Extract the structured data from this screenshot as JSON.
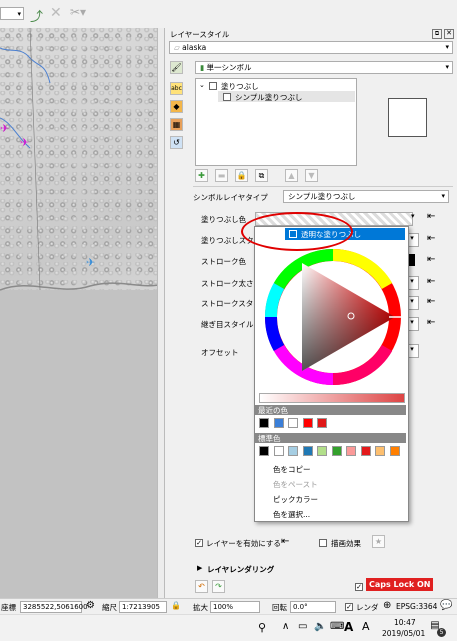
{
  "panel": {
    "title": "レイヤースタイル",
    "layer_name": "alaska",
    "renderer": "単一シンボル",
    "tree_fill": "塗りつぶし",
    "tree_simple_fill": "シンプル塗りつぶし",
    "symbol_layer_type_label": "シンボルレイヤタイプ",
    "symbol_layer_type_value": "シンプル塗りつぶし",
    "props": {
      "fill_color": "塗りつぶし色",
      "fill_style": "塗りつぶしスタイル",
      "stroke_color": "ストローク色",
      "stroke_width": "ストローク太さ",
      "stroke_style": "ストロークスタイル",
      "join_style": "継ぎ目スタイル",
      "offset": "オフセット"
    },
    "enable_layer": "レイヤーを有効にする",
    "draw_effects": "描画効果",
    "layer_rendering": "レイヤレンダリング"
  },
  "popup": {
    "transparent_fill": "透明な塗りつぶし",
    "recent_colors_label": "最近の色",
    "standard_colors_label": "標準色",
    "recent_colors": [
      "#000000",
      "#3b7fd8",
      "#ffffff",
      "#ff0000",
      "#e01818"
    ],
    "standard_colors": [
      "#000000",
      "#ffffff",
      "#a6cee3",
      "#1f78b4",
      "#b2df8a",
      "#33a02c",
      "#fb9a99",
      "#e31a1c",
      "#fdbf6f",
      "#ff7f00"
    ],
    "menu": {
      "copy_color": "色をコピー",
      "paste_color": "色をペースト",
      "pick_color": "ピックカラー",
      "choose_color": "色を選択..."
    }
  },
  "statusbar": {
    "coord_label": "座標",
    "coord_value": "3285522,5061600",
    "scale_label": "縮尺",
    "scale_value": "1:7213905",
    "magnifier_label": "拡大",
    "magnifier_value": "100%",
    "rotation_label": "回転",
    "rotation_value": "0.0°",
    "render_label": "レンダ",
    "crs": "EPSG:3364",
    "caps_lock": "Caps Lock ON"
  },
  "taskbar": {
    "time": "10:47",
    "date": "2019/05/01",
    "notifications": "5"
  },
  "colors": {
    "highlight": "#0078d7",
    "annotation_red": "#e00000",
    "caps_badge": "#e02020"
  }
}
